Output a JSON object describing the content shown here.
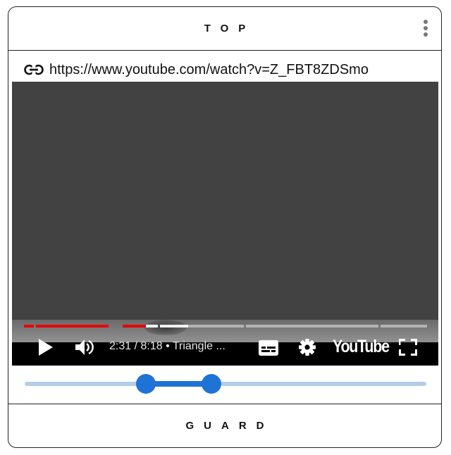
{
  "header": {
    "title": "TOP",
    "menu_icon": "more-vert-icon"
  },
  "link": {
    "icon": "link-icon",
    "url": "https://www.youtube.com/watch?v=Z_FBT8ZDSmo"
  },
  "player": {
    "time_label": "2:31 / 8:18 • Triangle ...",
    "progress_fraction": 0.303,
    "buffered_fraction": 0.408,
    "brand": "YouTube",
    "colors": {
      "progress": "#e60000",
      "controls_bg": "#000000",
      "video_bg": "#424242"
    },
    "icons": [
      "play-icon",
      "volume-icon",
      "subtitles-icon",
      "settings-gear-icon",
      "fullscreen-icon"
    ]
  },
  "range_slider": {
    "low_fraction": 0.301,
    "high_fraction": 0.465,
    "accent_color": "#1f73d6",
    "track_color": "#b3cde9"
  },
  "footer": {
    "title": "GUARD"
  }
}
